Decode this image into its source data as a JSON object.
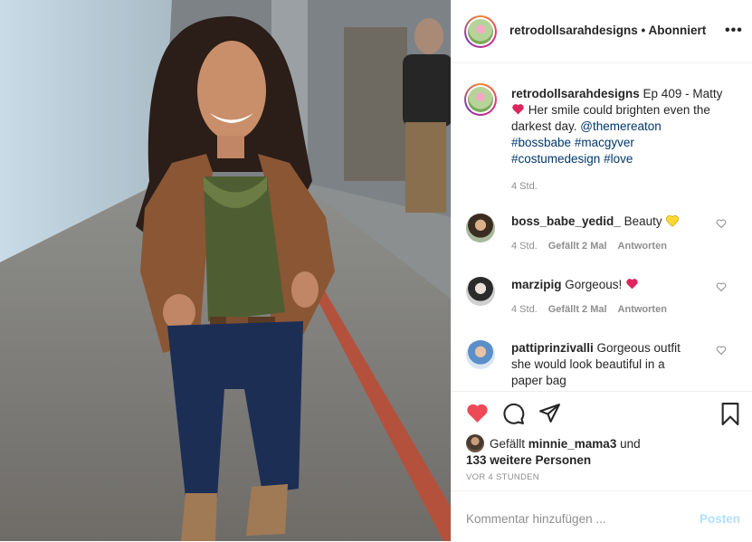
{
  "header": {
    "username": "retrodollsarahdesigns",
    "separator": " • ",
    "follow_status": "Abonniert",
    "more_label": "•••"
  },
  "caption": {
    "username": "retrodollsarahdesigns",
    "text_before_emoji": " Ep 409 - Matty ",
    "emoji": "heart-emoji",
    "text_after_emoji": " Her smile could brighten even the darkest day. ",
    "mention": "@themereaton",
    "hashtags": [
      "#bossbabe",
      "#macgyver",
      "#costumedesign",
      "#love"
    ],
    "time": "4 Std."
  },
  "comments": [
    {
      "username": "boss_babe_yedid_",
      "text": " Beauty ",
      "emoji": "yellow-heart-emoji",
      "time": "4 Std.",
      "likes": "Gefällt 2 Mal",
      "reply": "Antworten"
    },
    {
      "username": "marzipig",
      "text": " Gorgeous! ",
      "emoji": "heart-emoji",
      "time": "4 Std.",
      "likes": "Gefällt 2 Mal",
      "reply": "Antworten"
    },
    {
      "username": "pattiprinzivalli",
      "text": " Gorgeous outfit she would look beautiful in a paper bag",
      "emoji": "",
      "time": "",
      "likes": "",
      "reply": ""
    }
  ],
  "likes": {
    "prefix": "Gefällt ",
    "user": "minnie_mama3",
    "middle": " und ",
    "rest": "133 weitere Personen"
  },
  "posted_ago": "VOR 4 STUNDEN",
  "add_comment": {
    "placeholder": "Kommentar hinzufügen ...",
    "post_label": "Posten"
  },
  "colors": {
    "like_red": "#ed4956",
    "link_blue": "#00376b",
    "post_disabled": "#b2dffc",
    "yellow_heart": "#fdd835"
  },
  "icons": [
    "heart-icon",
    "comment-icon",
    "share-icon",
    "bookmark-icon",
    "more-icon"
  ]
}
